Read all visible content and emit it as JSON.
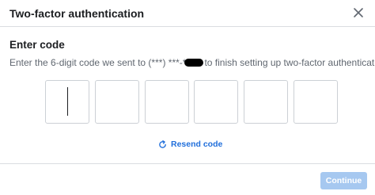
{
  "dialog": {
    "title": "Two-factor authentication"
  },
  "content": {
    "section_title": "Enter code",
    "description_before": "Enter the 6-digit code we sent to (***) ***-*",
    "description_after": "to finish setting up two-factor authentication."
  },
  "code_inputs": [
    "",
    "",
    "",
    "",
    "",
    ""
  ],
  "resend": {
    "label": "Resend code",
    "icon": "refresh-icon"
  },
  "footer": {
    "continue_label": "Continue",
    "continue_enabled": false
  },
  "colors": {
    "accent": "#216fdb",
    "disabled_button": "#a6c8f0",
    "border": "#ccd0d5"
  }
}
